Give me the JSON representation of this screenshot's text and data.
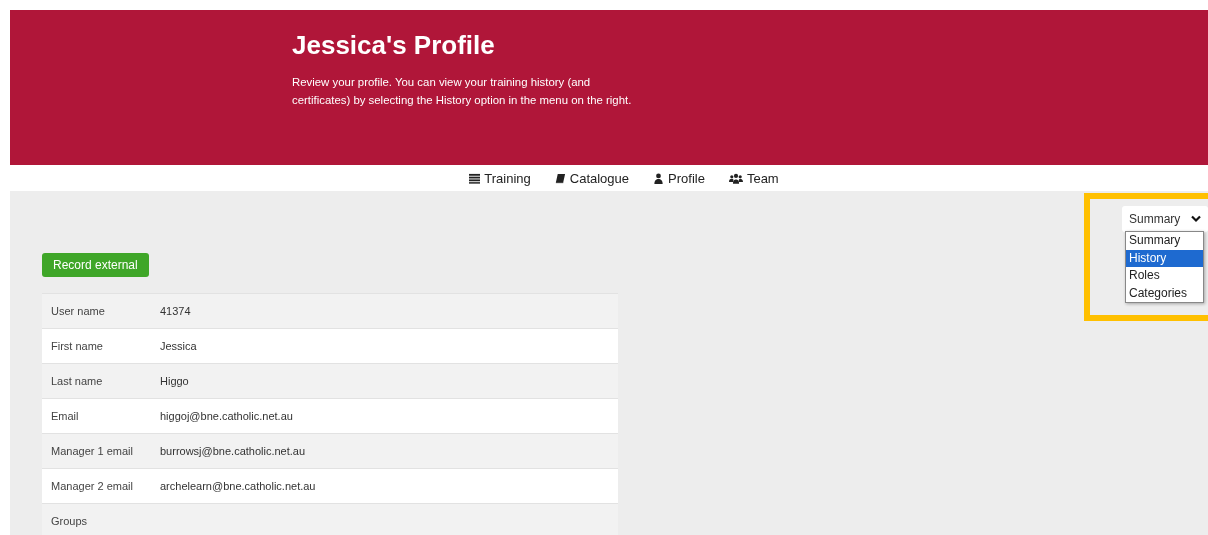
{
  "header": {
    "title": "Jessica's Profile",
    "description": "Review your profile. You can view your training history (and certificates) by selecting the History option in the menu on the right."
  },
  "nav": [
    {
      "kind": "list",
      "label": "Training"
    },
    {
      "kind": "book",
      "label": "Catalogue"
    },
    {
      "kind": "user",
      "label": "Profile"
    },
    {
      "kind": "users",
      "label": "Team"
    }
  ],
  "view_select": {
    "value": "Summary",
    "expanded": true,
    "options": [
      {
        "label": "Summary",
        "highlighted": false
      },
      {
        "label": "History",
        "highlighted": true
      },
      {
        "label": "Roles",
        "highlighted": false
      },
      {
        "label": "Categories",
        "highlighted": false
      }
    ]
  },
  "record_button": "Record external",
  "profile_rows": [
    {
      "label": "User name",
      "value": "41374"
    },
    {
      "label": "First name",
      "value": "Jessica"
    },
    {
      "label": "Last name",
      "value": "Higgo"
    },
    {
      "label": "Email",
      "value": "higgoj@bne.catholic.net.au"
    },
    {
      "label": "Manager 1 email",
      "value": "burrowsj@bne.catholic.net.au"
    },
    {
      "label": "Manager 2 email",
      "value": "archelearn@bne.catholic.net.au"
    },
    {
      "label": "Groups"
    }
  ]
}
